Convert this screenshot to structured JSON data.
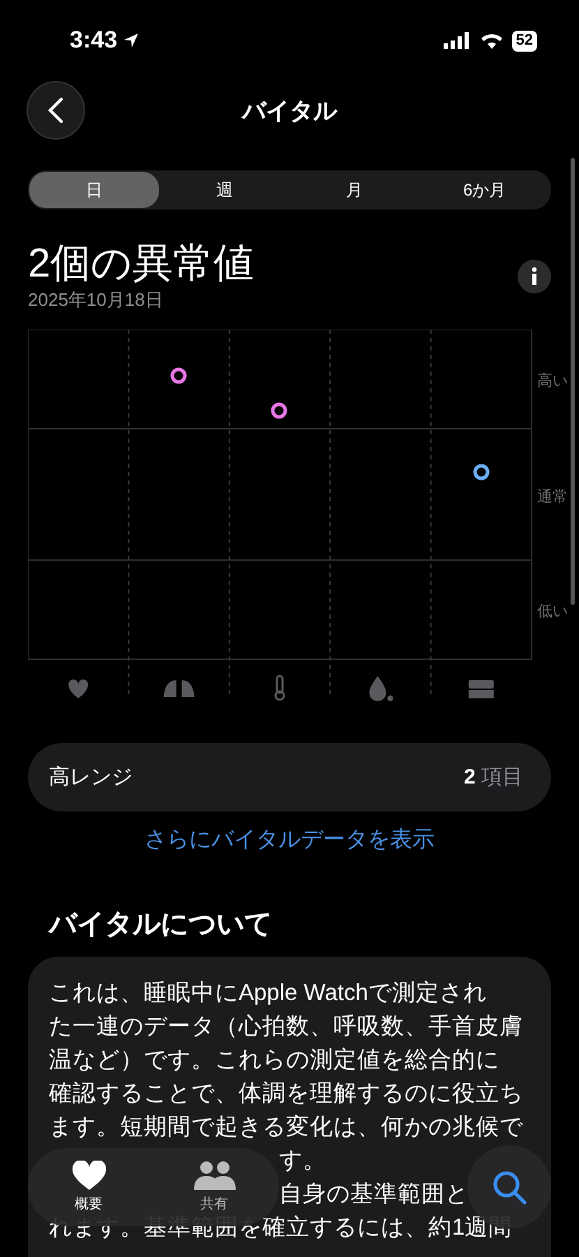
{
  "status_bar": {
    "time": "3:43",
    "battery": "52"
  },
  "nav": {
    "title": "バイタル"
  },
  "segments": [
    {
      "label": "日",
      "selected": true
    },
    {
      "label": "週",
      "selected": false
    },
    {
      "label": "月",
      "selected": false
    },
    {
      "label": "6か月",
      "selected": false
    }
  ],
  "header": {
    "title": "2個の異常値",
    "date": "2025年10月18日"
  },
  "chart": {
    "y_labels": [
      "高い",
      "通常",
      "低い"
    ],
    "markers": [
      {
        "color": "#e676e6"
      },
      {
        "color": "#e676e6"
      },
      {
        "color": "#6aaef5"
      }
    ]
  },
  "range_row": {
    "label": "高レンジ",
    "count": "2",
    "unit": "項目"
  },
  "more_link": "さらにバイタルデータを表示",
  "about": {
    "title": "バイタルについて",
    "lines": [
      {
        "kind": "full",
        "text": "これは、睡眠中にApple Watchで測定され"
      },
      {
        "kind": "full",
        "text": "た一連のデータ（心拍数、呼吸数、手首皮膚"
      },
      {
        "kind": "full",
        "text": "温など）です。これらの測定値を総合的に"
      },
      {
        "kind": "full",
        "text": "確認することで、体調を理解するのに役立ち"
      },
      {
        "kind": "full",
        "text": "ます。短期間で起きる変化は、何かの兆候で"
      },
      {
        "kind": "covered",
        "text": "す。"
      },
      {
        "kind": "covered",
        "text": "自身の基準範囲と"
      },
      {
        "kind": "full",
        "text": "れます。基準範囲を確立するには、約1週間"
      }
    ]
  },
  "tab_bar": {
    "items": [
      {
        "label": "概要",
        "selected": true
      },
      {
        "label": "共有",
        "selected": false
      }
    ]
  }
}
